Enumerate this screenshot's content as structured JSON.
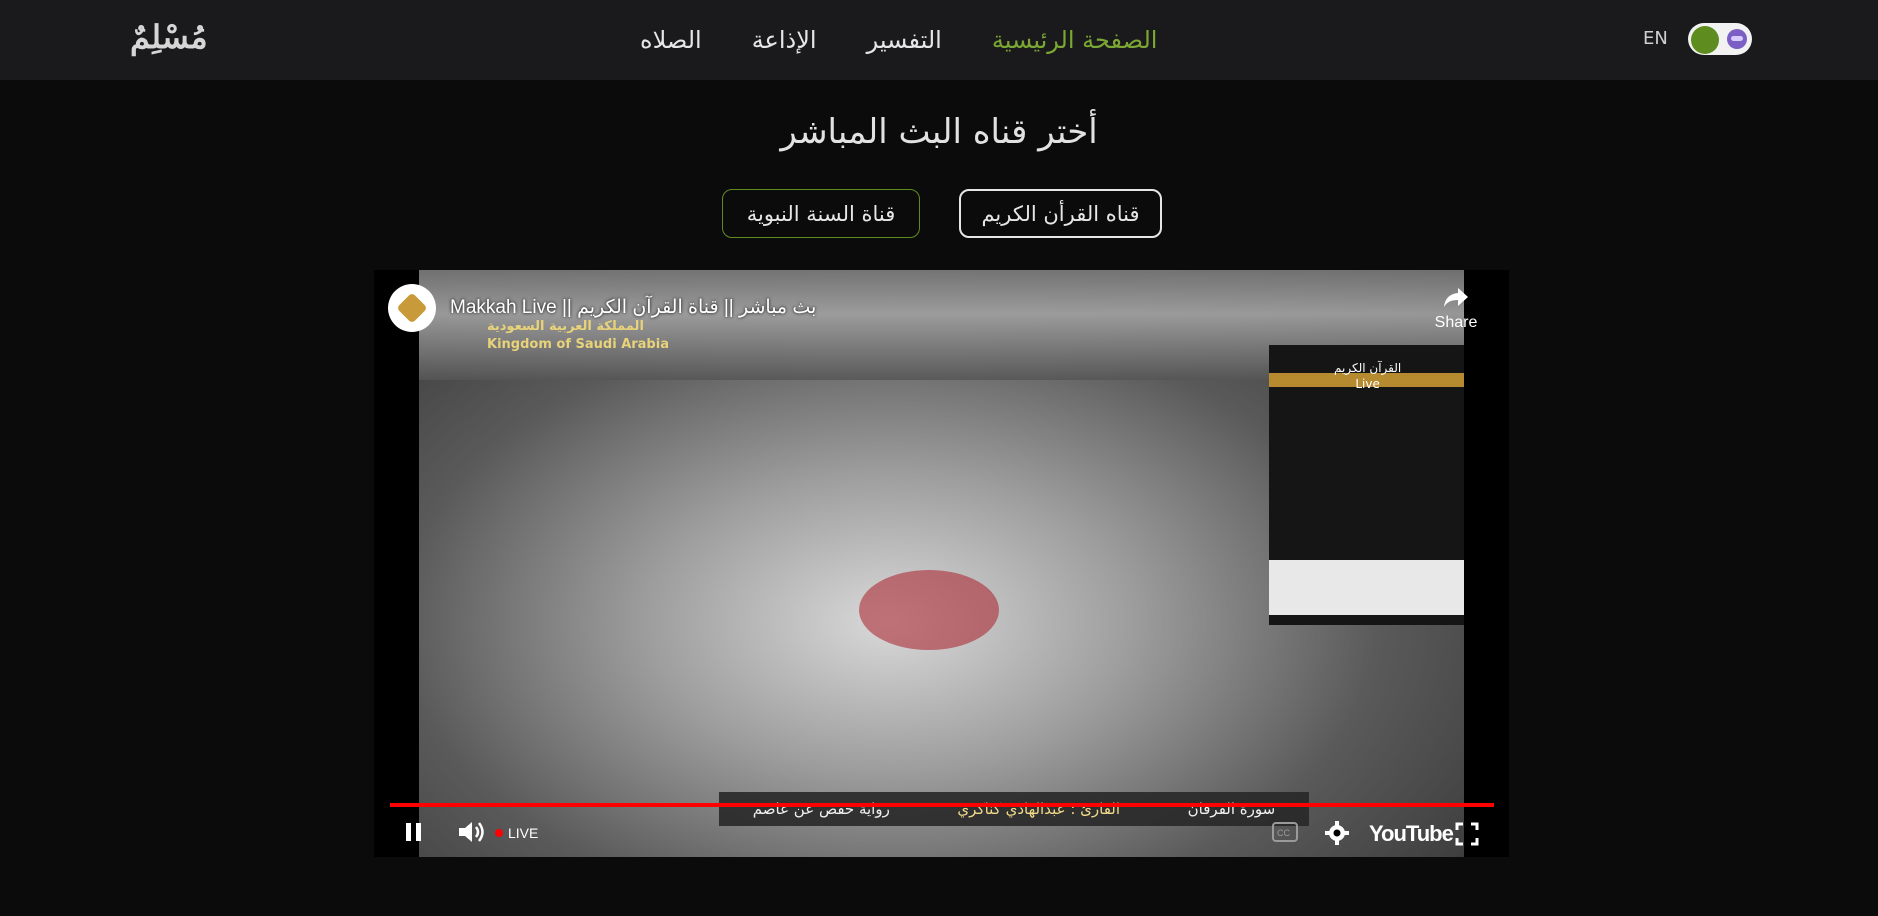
{
  "navbar": {
    "logo": "مُسْلِمٌ",
    "links": [
      {
        "label": "الصلاه",
        "active": false
      },
      {
        "label": "الإذاعة",
        "active": false
      },
      {
        "label": "التفسير",
        "active": false
      },
      {
        "label": "الصفحة الرئيسية",
        "active": true
      }
    ],
    "language": "EN",
    "theme_toggle": {
      "on": true,
      "icon": "moon-icon"
    }
  },
  "heading": "أختر قناه البث المباشر",
  "channels": {
    "quran": "قناه القرأن الكريم",
    "sunnah": "قناة السنة النبوية"
  },
  "player": {
    "title": "Makkah Live || بث مباشر || قناة القرآن الكريم",
    "share_label": "Share",
    "live_label": "LIVE",
    "progress": 1.0,
    "youtube_label": "YouTube",
    "overlay": {
      "country_ar": "المملكة العربية السعودية",
      "country_en": "Kingdom of Saudi Arabia",
      "brand_ar": "القرآن الكريم",
      "brand_en": "Live",
      "surah": "سورة الفرقان",
      "reciter": "القارئ : عبدالهادي كناكري",
      "riwaya": "رواية حفص عن عاصم"
    }
  },
  "colors": {
    "accent": "#7ba832",
    "navbar_bg": "#1a1a1c",
    "page_bg": "#0b0b0c",
    "progress": "#ff0000"
  }
}
